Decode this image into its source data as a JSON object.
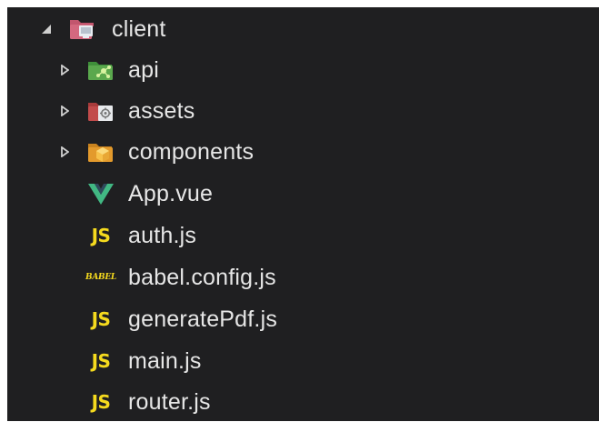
{
  "tree": {
    "root": {
      "label": "client",
      "expanded": true,
      "icon": "folder-client-open-icon"
    },
    "children": [
      {
        "label": "api",
        "type": "folder",
        "expanded": false,
        "icon": "folder-api-icon"
      },
      {
        "label": "assets",
        "type": "folder",
        "expanded": false,
        "icon": "folder-assets-icon"
      },
      {
        "label": "components",
        "type": "folder",
        "expanded": false,
        "icon": "folder-components-icon"
      },
      {
        "label": "App.vue",
        "type": "file",
        "icon": "vue-icon"
      },
      {
        "label": "auth.js",
        "type": "file",
        "icon": "js-icon",
        "icon_text": "JS"
      },
      {
        "label": "babel.config.js",
        "type": "file",
        "icon": "babel-icon",
        "icon_text": "BABEL"
      },
      {
        "label": "generatePdf.js",
        "type": "file",
        "icon": "js-icon",
        "icon_text": "JS"
      },
      {
        "label": "main.js",
        "type": "file",
        "icon": "js-icon",
        "icon_text": "JS"
      },
      {
        "label": "router.js",
        "type": "file",
        "icon": "js-icon",
        "icon_text": "JS"
      }
    ]
  },
  "colors": {
    "background": "#1f1f21",
    "text": "#e6e6e6",
    "js_yellow": "#f5da1e",
    "vue_green": "#41b883"
  }
}
